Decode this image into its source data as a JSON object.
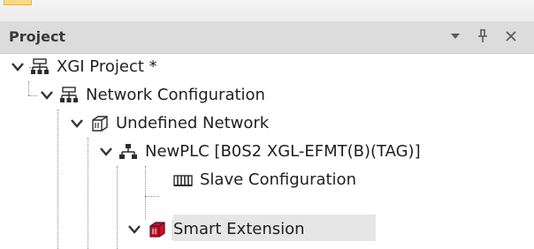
{
  "panel": {
    "title": "Project",
    "buttons": {
      "dropdown": "dropdown-arrow-icon",
      "pin": "pin-icon",
      "close": "close-icon"
    }
  },
  "tree": {
    "items": [
      {
        "label": "XGI Project *",
        "icon": "project-network-icon",
        "expanded": true
      },
      {
        "label": "Network Configuration",
        "icon": "project-network-icon",
        "expanded": true
      },
      {
        "label": "Undefined Network",
        "icon": "network-cube-icon",
        "expanded": true
      },
      {
        "label": "NewPLC [B0S2 XGL-EFMT(B)(TAG)]",
        "icon": "plc-topology-icon",
        "expanded": true
      },
      {
        "label": "Slave Configuration",
        "icon": "slave-config-icon",
        "expanded": false
      },
      {
        "label": "Smart Extension",
        "icon": "smart-extension-icon",
        "expanded": true,
        "selected": true
      }
    ]
  },
  "colors": {
    "header_bg": "#dcdcdc",
    "selection_bg": "#e6e6e6",
    "smart_extension_icon": "#c8102e"
  }
}
